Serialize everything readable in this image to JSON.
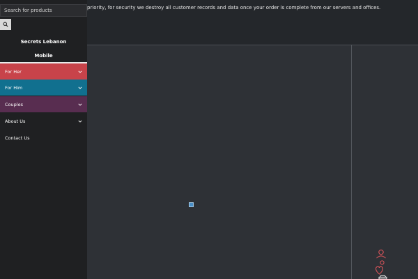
{
  "notice": {
    "text": "priority, for security we destroy all customer records and data once your order is complete from our servers and offices."
  },
  "sidebar": {
    "search": {
      "placeholder": "Search for products",
      "button_icon": "search-icon"
    },
    "brand": {
      "line1": "Secrets Lebanon",
      "line2": "Mobile"
    },
    "menu": [
      {
        "label": "For Her",
        "color": "#c8434a",
        "has_submenu": true
      },
      {
        "label": "For Him",
        "color": "#11708f",
        "has_submenu": true
      },
      {
        "label": "Couples",
        "color": "#582d50",
        "has_submenu": true
      },
      {
        "label": "About Us",
        "color": "#1f2022",
        "has_submenu": true
      },
      {
        "label": "Contact Us",
        "color": "#1f2022",
        "has_submenu": false
      }
    ]
  },
  "floating_icons": [
    "user-icon",
    "heart-icon",
    "basket-icon"
  ],
  "colors": {
    "page_background": "#2c2f34",
    "sidebar_background": "#1f2022",
    "accent_red": "#c8434a"
  }
}
